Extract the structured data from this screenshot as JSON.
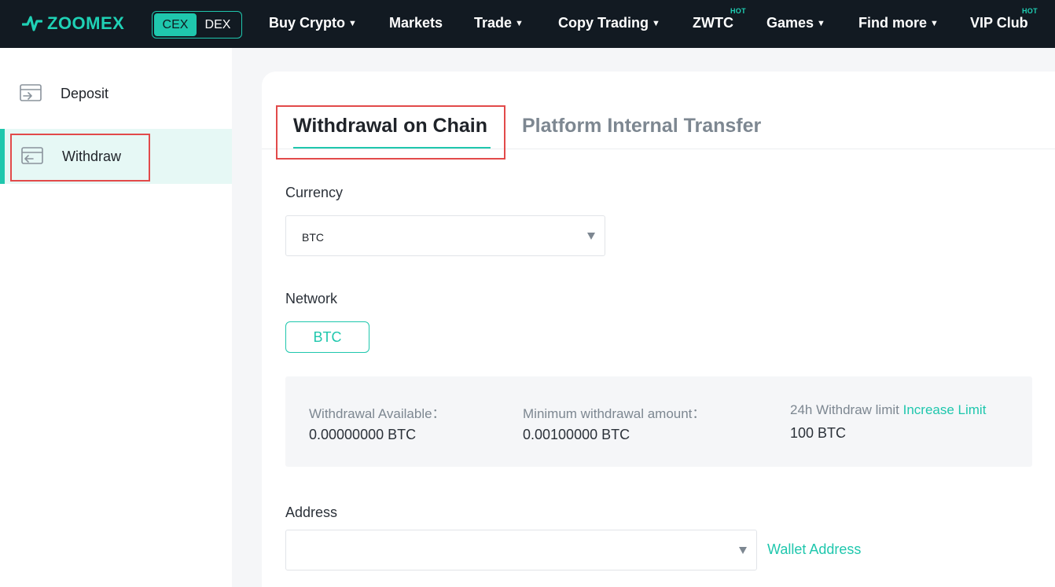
{
  "brand": {
    "name": "ZOOMEX",
    "accent": "#1fc7ad"
  },
  "mode_toggle": {
    "active": "CEX",
    "inactive": "DEX"
  },
  "nav": {
    "buy_crypto": "Buy Crypto",
    "markets": "Markets",
    "trade": "Trade",
    "copy_trading": "Copy Trading",
    "zwtc": "ZWTC",
    "zwtc_badge": "HOT",
    "games": "Games",
    "find_more": "Find more",
    "vip_club": "VIP Club",
    "vip_badge": "HOT"
  },
  "sidebar": {
    "items": [
      {
        "label": "Deposit",
        "icon": "deposit-icon"
      },
      {
        "label": "Withdraw",
        "icon": "withdraw-icon",
        "active": true
      }
    ]
  },
  "tabs": {
    "active": "Withdrawal on Chain",
    "inactive": "Platform Internal Transfer"
  },
  "form": {
    "currency_label": "Currency",
    "currency_value": "BTC",
    "network_label": "Network",
    "network_value": "BTC",
    "address_label": "Address",
    "address_value": "",
    "wallet_link": "Wallet Address"
  },
  "info": {
    "available_label": "Withdrawal Available：",
    "available_value": "0.00000000 BTC",
    "min_label": "Minimum withdrawal amount：",
    "min_value": "0.00100000 BTC",
    "limit_label": "24h Withdraw limit",
    "limit_link": "Increase Limit",
    "limit_value": "100 BTC"
  }
}
